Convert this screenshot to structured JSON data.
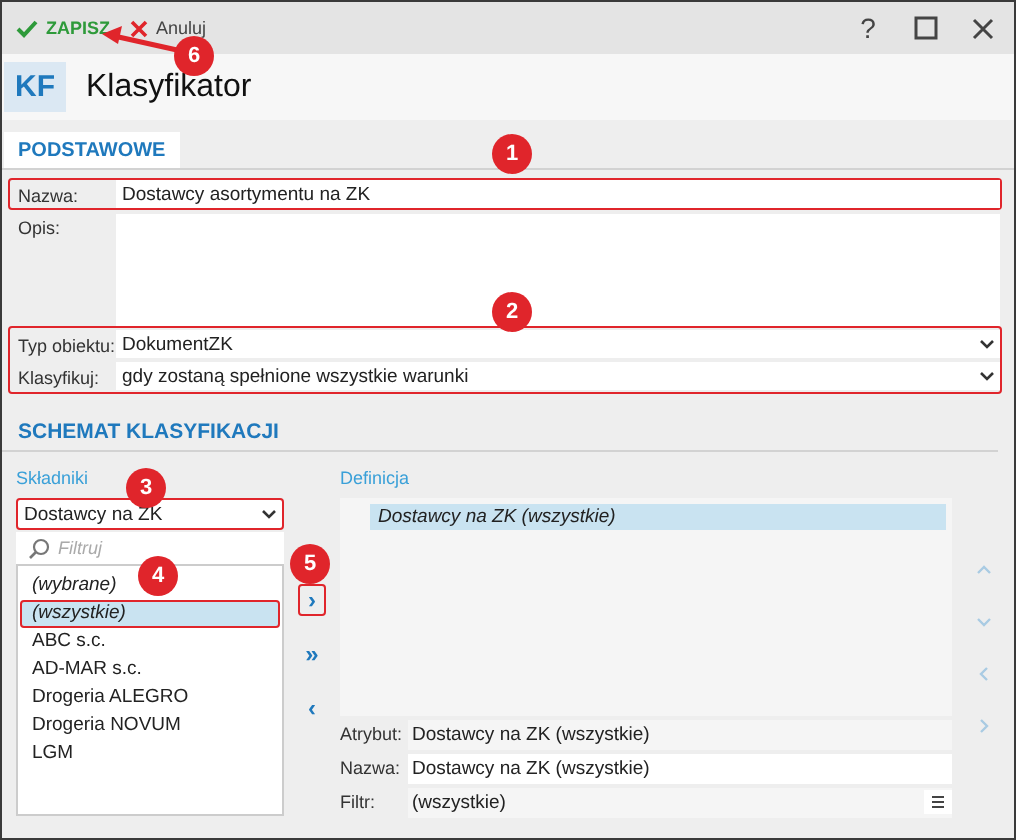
{
  "toolbar": {
    "buttons": [
      {
        "label": "ZAPISZ",
        "kind": "save"
      },
      {
        "label": "Anuluj",
        "kind": "cancel"
      }
    ],
    "help": "?"
  },
  "header": {
    "logo": "KF",
    "title": "Klasyfikator"
  },
  "tabs": [
    {
      "label": "PODSTAWOWE",
      "selected": true
    }
  ],
  "fields": [
    {
      "label": "Nazwa:",
      "value": "Dostawcy asortymentu na ZK",
      "kind": "text",
      "highlighted": true
    },
    {
      "label": "Opis:",
      "kind": "textarea",
      "highlighted": false
    }
  ],
  "object_fields": {
    "highlighted": true,
    "rows": [
      {
        "label": "Typ obiektu:",
        "value": "DokumentZK"
      },
      {
        "label": "Klasyfikuj:",
        "value": "gdy zostaną spełnione wszystkie warunki"
      }
    ]
  },
  "section_title": "SCHEMAT KLASYFIKACJI",
  "components": {
    "label": "Składniki",
    "select": {
      "value": "Dostawcy na ZK",
      "highlighted": true
    },
    "filter": {
      "placeholder": "Filtruj"
    },
    "items": [
      {
        "label": "(wybrane)",
        "kind": "special",
        "selected": false,
        "highlighted": false
      },
      {
        "label": "(wszystkie)",
        "kind": "special",
        "selected": true,
        "highlighted": true
      },
      {
        "label": "ABC s.c.",
        "kind": "entry",
        "selected": false,
        "highlighted": false
      },
      {
        "label": "AD-MAR s.c.",
        "kind": "entry",
        "selected": false,
        "highlighted": false
      },
      {
        "label": "Drogeria ALEGRO",
        "kind": "entry",
        "selected": false,
        "highlighted": false
      },
      {
        "label": "Drogeria NOVUM",
        "kind": "entry",
        "selected": false,
        "highlighted": false
      },
      {
        "label": "LGM",
        "kind": "entry",
        "selected": false,
        "highlighted": false
      }
    ]
  },
  "transfer_buttons": [
    {
      "label": "›",
      "highlighted": true
    },
    {
      "label": "»",
      "highlighted": false
    },
    {
      "label": "‹",
      "highlighted": false
    }
  ],
  "definition": {
    "label": "Definicja",
    "items": [
      {
        "label": "Dostawcy na ZK (wszystkie)",
        "selected": true
      }
    ],
    "attributes": [
      {
        "label": "Atrybut:",
        "value": "Dostawcy na ZK (wszystkie)",
        "kind": "readonly"
      },
      {
        "label": "Nazwa:",
        "value": "Dostawcy na ZK (wszystkie)",
        "kind": "input"
      },
      {
        "label": "Filtr:",
        "value": "(wszystkie)",
        "kind": "menu"
      }
    ]
  },
  "annotations": [
    {
      "label": "1",
      "kind": "badge"
    },
    {
      "label": "2",
      "kind": "badge"
    },
    {
      "label": "3",
      "kind": "badge"
    },
    {
      "label": "4",
      "kind": "badge"
    },
    {
      "label": "5",
      "kind": "badge"
    },
    {
      "label": "6",
      "kind": "arrow"
    }
  ]
}
